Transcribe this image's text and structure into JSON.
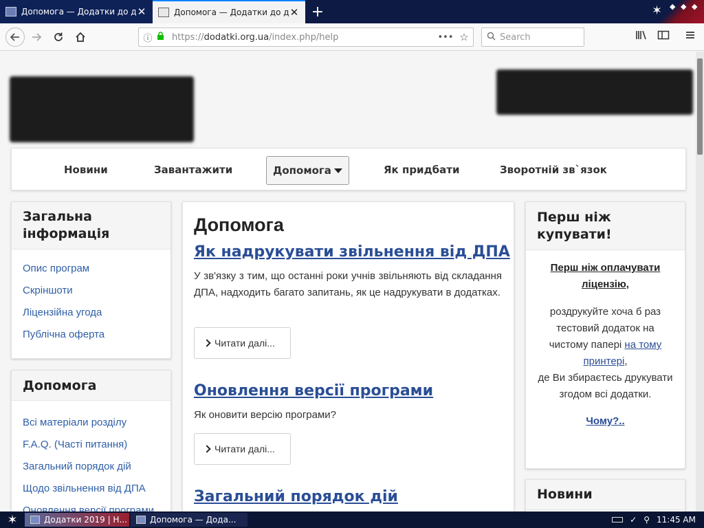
{
  "browser": {
    "tabs": [
      {
        "title": "Допомога — Додатки до докуме",
        "state": "inactive"
      },
      {
        "title": "Допомога — Додатки до докуме",
        "state": "active"
      }
    ],
    "new_tab_symbol": "+",
    "close_symbol": "✕",
    "url_scheme": "https://",
    "url_host": "dodatki.org.ua",
    "url_path": "/index.php/help",
    "search_placeholder": "Search",
    "icons": [
      "back-icon",
      "forward-icon",
      "reload-icon",
      "home-icon",
      "info-icon",
      "lock-icon",
      "page-actions-icon",
      "bookmark-star-icon",
      "search-icon",
      "library-icon",
      "sidebar-icon",
      "menu-icon"
    ]
  },
  "site": {
    "menu": {
      "items": [
        "Новини",
        "Завантажити",
        "Допомога",
        "Як придбати",
        "Зворотній зв`язок"
      ],
      "active_index": 2
    },
    "left_sidebar": {
      "general": {
        "title": "Загальна інформація",
        "links": [
          "Опис програм",
          "Скріншоти",
          "Ліцензійна угода",
          "Публічна оферта"
        ]
      },
      "help": {
        "title": "Допомога",
        "links": [
          "Всі матеріали розділу",
          "F.A.Q. (Часті питання)",
          "Загальний порядок дій",
          "Щодо звільнення від ДПА",
          "Оновлення версії програми"
        ]
      }
    },
    "content": {
      "title": "Допомога",
      "articles": [
        {
          "title": "Як надрукувати звільнення від ДПА",
          "text": "У зв'язку з тим, що останні роки учнів звільняють від складання ДПА, надходить багато запитань, як це надрукувати в додатках.",
          "read_more": "Читати далі..."
        },
        {
          "title": "Оновлення версії програми",
          "text": "Як оновити версію програми?",
          "read_more": "Читати далі..."
        },
        {
          "title": "Загальний порядок дій"
        }
      ]
    },
    "right_sidebar": {
      "before": {
        "title": "Перш ніж купувати!",
        "link1": "Перш ніж оплачувати ліцензію,",
        "text1": "роздрукуйте хоча б раз тестовий додаток на чистому папері",
        "link2": "на тому принтері",
        "comma": ",",
        "text2": "де Ви збираєтесь друкувати згодом всі додатки.",
        "why": "Чому?.."
      },
      "news": {
        "title": "Новини"
      }
    }
  },
  "taskbar": {
    "items": [
      "Додатки 2019 | Н...",
      "Допомога — Дода..."
    ],
    "clock": "11:45 AM"
  },
  "colors": {
    "link": "#2f5fa7",
    "title_link": "#2a4e96",
    "tab_dark": "#0c1a44",
    "secure_green": "#12bc00"
  }
}
